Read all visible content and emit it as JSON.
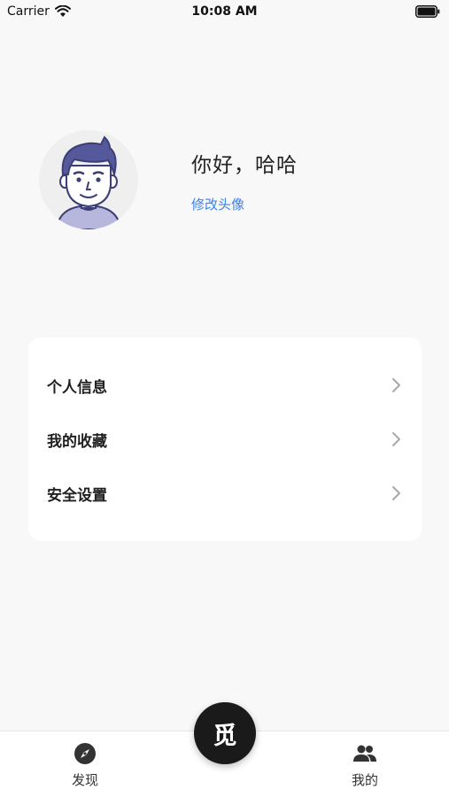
{
  "status_bar": {
    "carrier": "Carrier",
    "time": "10:08 AM",
    "icons": [
      "wifi-icon",
      "battery-icon"
    ]
  },
  "profile": {
    "greeting": "你好，哈哈",
    "change_avatar": "修改头像",
    "avatar_icon": "avatar"
  },
  "menu": {
    "items": [
      {
        "label": "个人信息",
        "icon": "chevron-right-icon"
      },
      {
        "label": "我的收藏",
        "icon": "chevron-right-icon"
      },
      {
        "label": "安全设置",
        "icon": "chevron-right-icon"
      }
    ]
  },
  "tab_bar": {
    "discover": {
      "label": "发现",
      "icon": "compass-icon"
    },
    "center": {
      "label": "觅"
    },
    "mine": {
      "label": "我的",
      "icon": "people-icon"
    }
  },
  "colors": {
    "accent": "#3c82e8",
    "background": "#f8f8f8",
    "card": "#ffffff",
    "fab": "#1a1a1a"
  }
}
